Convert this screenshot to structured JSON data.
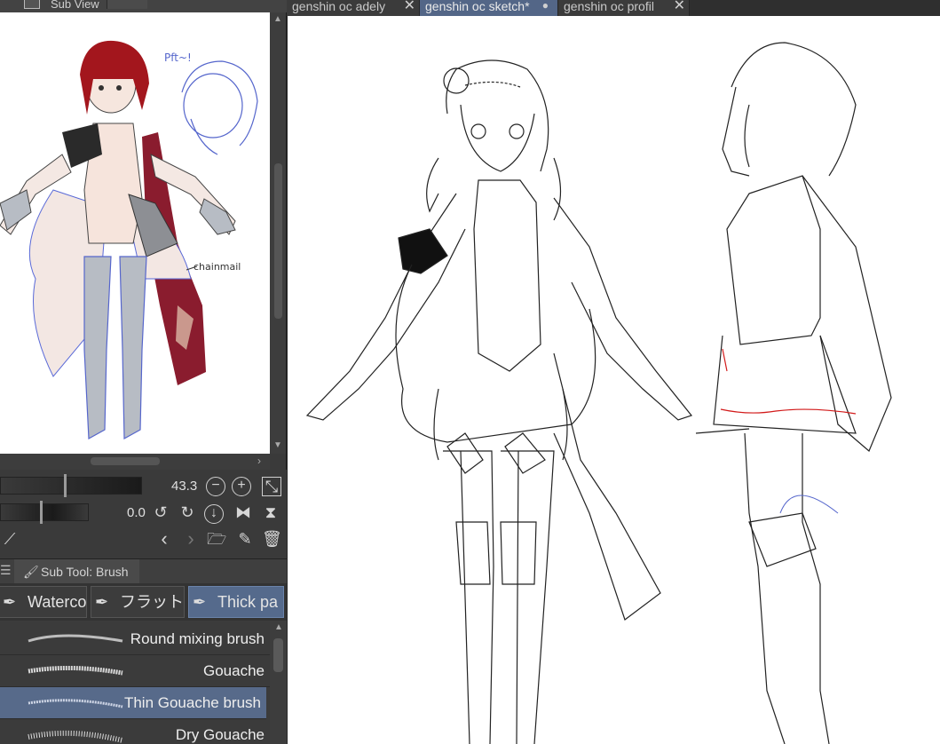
{
  "subview": {
    "title": "Sub View",
    "annotation_pft": "Pft~!",
    "annotation_chainmail": "chainmail"
  },
  "navigator": {
    "zoom_value": "43.3",
    "rotate_value": "0.0"
  },
  "subtool": {
    "panel_title": "Sub Tool: Brush",
    "tabs": [
      {
        "label": "Waterco",
        "icon": "watercolor-brush-icon",
        "active": false
      },
      {
        "label": "フラット",
        "icon": "flat-brush-icon",
        "active": false
      },
      {
        "label": "Thick pa",
        "icon": "thick-paint-brush-icon",
        "active": true
      }
    ],
    "brushes": [
      {
        "name": "Round mixing brush",
        "selected": false
      },
      {
        "name": "Gouache",
        "selected": false
      },
      {
        "name": "Thin Gouache brush",
        "selected": true
      },
      {
        "name": "Dry Gouache",
        "selected": false
      }
    ]
  },
  "documents": {
    "tabs": [
      {
        "label": "genshin oc adely",
        "active": false
      },
      {
        "label": "genshin oc sketch*",
        "active": true
      },
      {
        "label": "genshin oc profil",
        "active": false
      }
    ]
  },
  "colors": {
    "active_tab": "#536687",
    "selected_brush": "#576a8a",
    "panel_bg": "#3a3a3a",
    "hair_red": "#a3161d",
    "cape_crimson": "#8a1c2e",
    "sketch_blue": "#5566cc"
  }
}
